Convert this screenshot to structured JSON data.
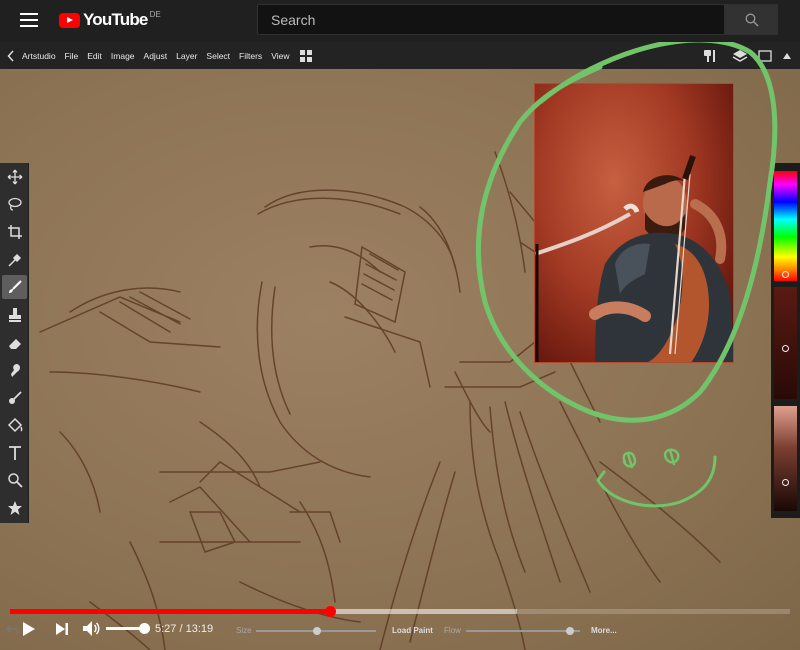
{
  "youtube": {
    "logo_text": "YouTube",
    "region": "DE",
    "search_placeholder": "Search"
  },
  "artstudio": {
    "menu": [
      "Artstudio",
      "File",
      "Edit",
      "Image",
      "Adjust",
      "Layer",
      "Select",
      "Filters",
      "View"
    ]
  },
  "tools": [
    "move-tool",
    "lasso-tool",
    "crop-tool",
    "eyedropper-tool",
    "brush-tool",
    "stamp-tool",
    "eraser-tool",
    "smudge-tool",
    "blur-tool",
    "fill-tool",
    "text-tool",
    "zoom-tool",
    "favorites-tool"
  ],
  "active_tool": "brush-tool",
  "colors": {
    "youtube_red": "#ff0000",
    "stroke_green": "#72c46a",
    "sketch_brown": "#5e3a24"
  },
  "player": {
    "current_time": "5:27",
    "separator": "/",
    "duration": "13:19",
    "progress_fraction": 0.41,
    "buffered_fraction": 0.65,
    "volume_fraction": 0.9
  },
  "brush_bar": {
    "size_label": "Size",
    "load_paint_label": "Load Paint",
    "flow_label": "Flow",
    "more_label": "More..."
  }
}
